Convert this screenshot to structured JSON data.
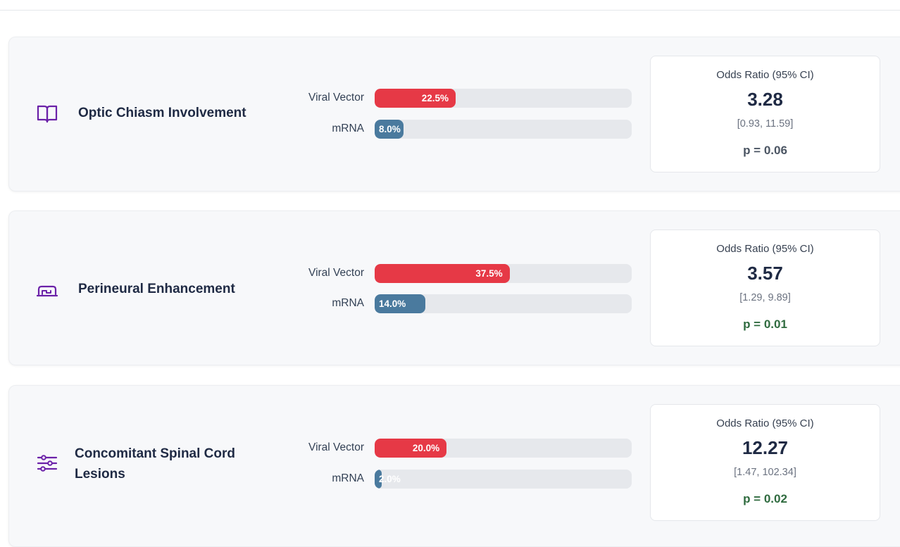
{
  "colors": {
    "viral_vector": "#e63946",
    "mrna": "#4a7a9e",
    "icon": "#6b21a8",
    "p_significant": "#2f6b3f",
    "p_not_significant": "#4b5563"
  },
  "features": [
    {
      "title": "Optic Chiasm Involvement",
      "icon": "book-open-icon",
      "viral_vector": {
        "label": "Viral Vector",
        "value_text": "22.5%",
        "value": 22.5
      },
      "mrna": {
        "label": "mRNA",
        "value_text": "8.0%",
        "value": 8.0
      },
      "odds_ratio": {
        "title": "Odds Ratio (95% CI)",
        "value": "3.28",
        "ci": "[0.93, 11.59]",
        "p": "p = 0.06"
      }
    },
    {
      "title": "Perineural Enhancement",
      "icon": "nerve-sheath-icon",
      "viral_vector": {
        "label": "Viral Vector",
        "value_text": "37.5%",
        "value": 37.5
      },
      "mrna": {
        "label": "mRNA",
        "value_text": "14.0%",
        "value": 14.0
      },
      "odds_ratio": {
        "title": "Odds Ratio (95% CI)",
        "value": "3.57",
        "ci": "[1.29, 9.89]",
        "p": "p = 0.01"
      }
    },
    {
      "title": "Concomitant Spinal Cord Lesions",
      "icon": "sliders-icon",
      "viral_vector": {
        "label": "Viral Vector",
        "value_text": "20.0%",
        "value": 20.0
      },
      "mrna": {
        "label": "mRNA",
        "value_text": "2.0%",
        "value": 2.0
      },
      "odds_ratio": {
        "title": "Odds Ratio (95% CI)",
        "value": "12.27",
        "ci": "[1.47, 102.34]",
        "p": "p = 0.02"
      }
    }
  ]
}
